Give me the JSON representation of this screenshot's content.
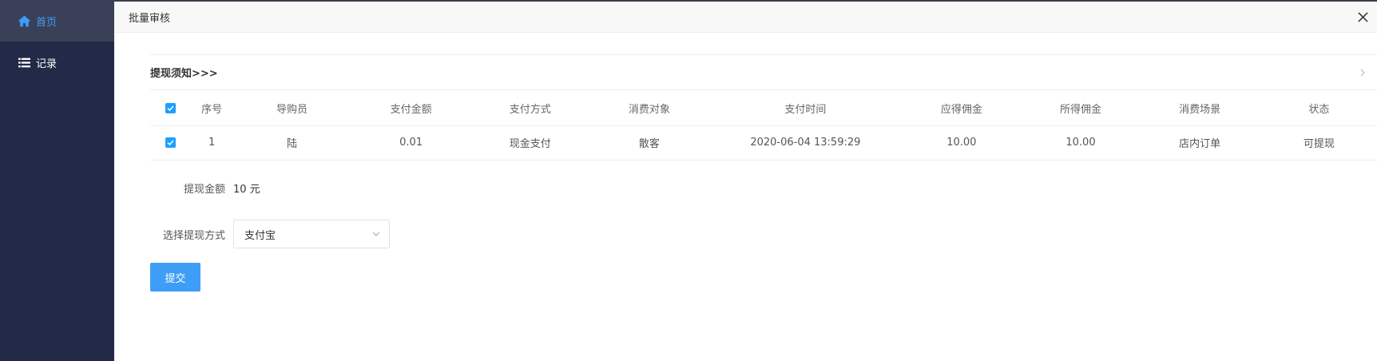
{
  "sidebar": {
    "items": [
      {
        "label": "首页",
        "icon": "home-icon",
        "active": true
      },
      {
        "label": "记录",
        "icon": "list-icon",
        "active": false
      }
    ]
  },
  "dialog": {
    "title": "批量审核",
    "notice": "提现须知>>>",
    "table": {
      "headers": [
        "序号",
        "导购员",
        "支付金额",
        "支付方式",
        "消费对象",
        "支付时间",
        "应得佣金",
        "所得佣金",
        "消费场景",
        "状态"
      ],
      "rows": [
        [
          "1",
          "陆",
          "0.01",
          "现金支付",
          "散客",
          "2020-06-04 13:59:29",
          "10.00",
          "10.00",
          "店内订单",
          "可提现"
        ]
      ]
    },
    "amount": {
      "label": "提现金额",
      "value": "10 元"
    },
    "method": {
      "label": "选择提现方式",
      "value": "支付宝"
    },
    "submit_label": "提交"
  },
  "colors": {
    "accent": "#3e9ef7",
    "sidebar_bg": "#232a47",
    "checkbox": "#1e9fff"
  }
}
